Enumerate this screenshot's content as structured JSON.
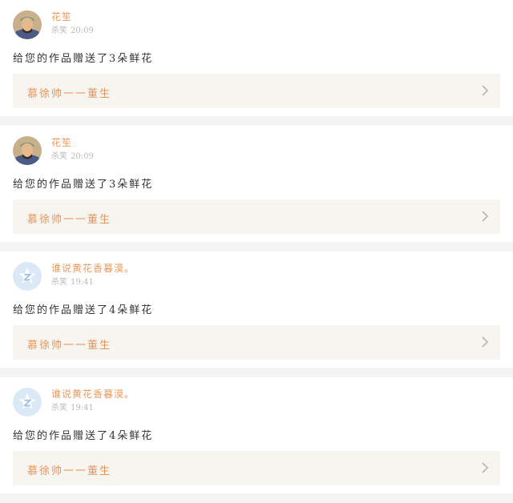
{
  "items": [
    {
      "avatar": "warrior",
      "name": "花笙",
      "action": "杀笑",
      "time": "20:09",
      "message": "给您的作品赠送了3朵鲜花",
      "work_title": "慕徐帅一一董生"
    },
    {
      "avatar": "warrior",
      "name": "花笙",
      "action": "杀笑",
      "time": "20:09",
      "message": "给您的作品赠送了3朵鲜花",
      "work_title": "慕徐帅一一董生"
    },
    {
      "avatar": "default",
      "name": "谁说黄花香暮漠。",
      "action": "杀笑",
      "time": "19:41",
      "message": "给您的作品赠送了4朵鲜花",
      "work_title": "慕徐帅一一董生"
    },
    {
      "avatar": "default",
      "name": "谁说黄花香暮漠。",
      "action": "杀笑",
      "time": "19:41",
      "message": "给您的作品赠送了4朵鲜花",
      "work_title": "慕徐帅一一董生"
    }
  ]
}
